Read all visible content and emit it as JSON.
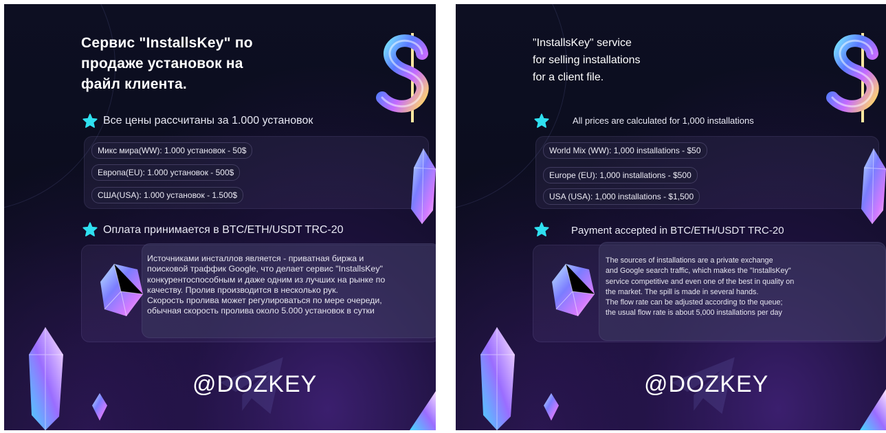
{
  "left": {
    "title": "Сервис \"InstallsKey\" по\nпродаже установок на\nфайл клиента.",
    "prices_heading": "Все цены рассчитаны за 1.000 установок",
    "prices": [
      "Микс мира(WW): 1.000 установок - 50$",
      "Европа(EU): 1.000 установок - 500$",
      "США(USA): 1.000 установок - 1.500$"
    ],
    "payment_heading": "Оплата принимается в BTC/ETH/USDT TRC-20",
    "description": "Источниками инсталлов является - приватная биржа и\nпоисковой траффик Google, что делает сервис \"InstallsKey\"\nконкурентоспособным и даже одним из лучших на рынке по\nкачеству. Пролив производится в несколько рук.\nСкорость пролива может регулироваться по мере очереди,\nобычная скорость пролива около 5.000 установок в сутки",
    "handle": "@DOZKEY"
  },
  "right": {
    "title": "\"InstallsKey\" service\nfor selling installations\nfor a client file.",
    "prices_heading": "All prices are calculated for 1,000 installations",
    "prices": [
      "World Mix (WW): 1,000 installations - $50",
      "Europe (EU): 1,000 installations - $500",
      "USA (USA): 1,000 installations - $1,500"
    ],
    "payment_heading": "Payment accepted in BTC/ETH/USDT TRC-20",
    "description": "The sources of installations are a private exchange\nand Google search traffic, which makes the \"InstallsKey\"\nservice competitive and even one of the best in quality on\nthe market. The spill is made in several hands.\nThe flow rate can be adjusted according to the queue;\nthe usual flow rate is about 5,000 installations per day",
    "handle": "@DOZKEY"
  },
  "colors": {
    "accent_star": "#2fe0f0",
    "background": "#0d0f22",
    "text": "#ffffff"
  },
  "icons": [
    "star-icon",
    "dollar-sign-icon",
    "crystal-icon",
    "telegram-plane-icon"
  ]
}
